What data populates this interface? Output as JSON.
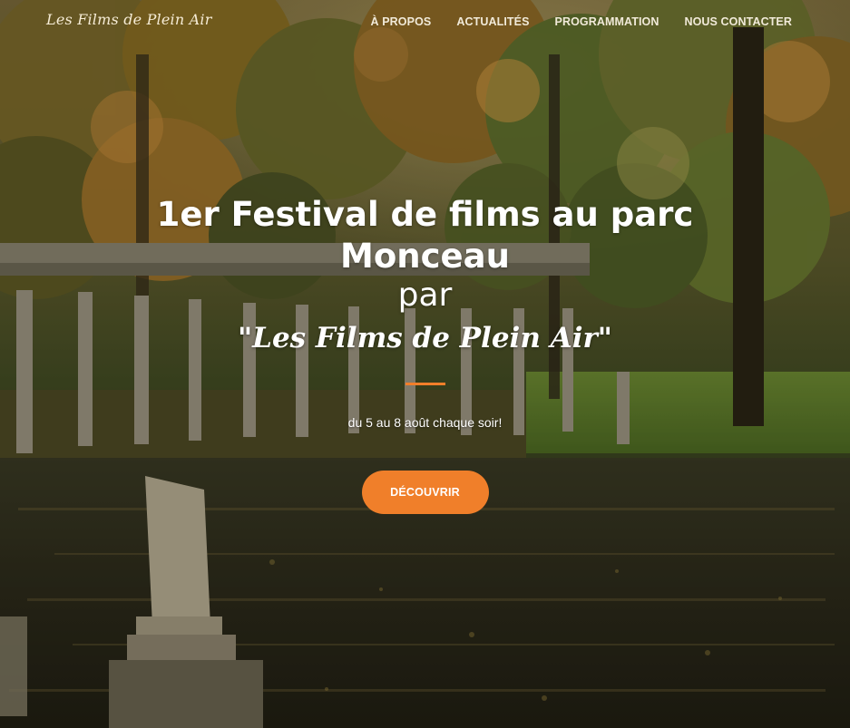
{
  "nav": {
    "brand": "Les Films de Plein Air",
    "links": [
      "À PROPOS",
      "ACTUALITÉS",
      "PROGRAMMATION",
      "NOUS CONTACTER"
    ]
  },
  "hero": {
    "title": "1er Festival de films au parc Monceau",
    "par": "par",
    "brand_quote": "\"Les Films de Plein Air\"",
    "subtitle": "du 5 au 8 août chaque soir!",
    "cta_label": "DÉCOUVRIR"
  },
  "colors": {
    "accent": "#f07f2a",
    "text": "#ffffff"
  }
}
